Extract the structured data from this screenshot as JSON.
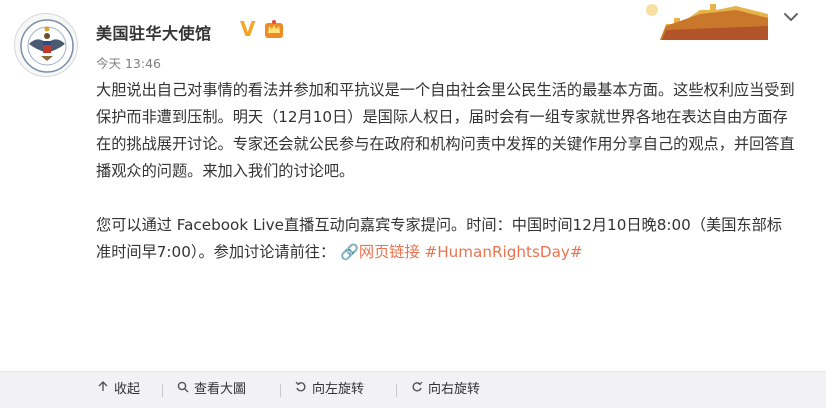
{
  "post": {
    "author": "美国驻华大使馆",
    "verified_badge": "V",
    "timestamp": "今天 13:46",
    "paragraph1": "大胆说出自己对事情的看法并参加和平抗议是一个自由社会里公民生活的最基本方面。这些权利应当受到保护而非遭到压制。明天（12月10日）是国际人权日，届时会有一组专家就世界各地在表达自由方面存在的挑战展开讨论。专家还会就公民参与在政府和机构问责中发挥的关键作用分享自己的观点，并回答直播观众的问题。来加入我们的讨论吧。",
    "paragraph2_text": "您可以通过 Facebook Live直播互动向嘉宾专家提问。时间：中国时间12月10日晚8:00（美国东部标准时间早7:00）。参加讨论请前往：",
    "link_icon": "🔗",
    "link_text": "网页链接",
    "hashtag": "#HumanRightsDay#"
  },
  "toolbar": {
    "collapse": "收起",
    "view_large": "查看大圖",
    "rotate_left": "向左旋转",
    "rotate_right": "向右旋转"
  },
  "icons": {
    "avatar": "embassy-seal-icon",
    "vip": "vip-crown-icon",
    "more": "chevron-down-icon"
  },
  "colors": {
    "accent": "#eb7350",
    "verified": "#f5a623",
    "toolbar_bg": "#f2f2f5"
  }
}
